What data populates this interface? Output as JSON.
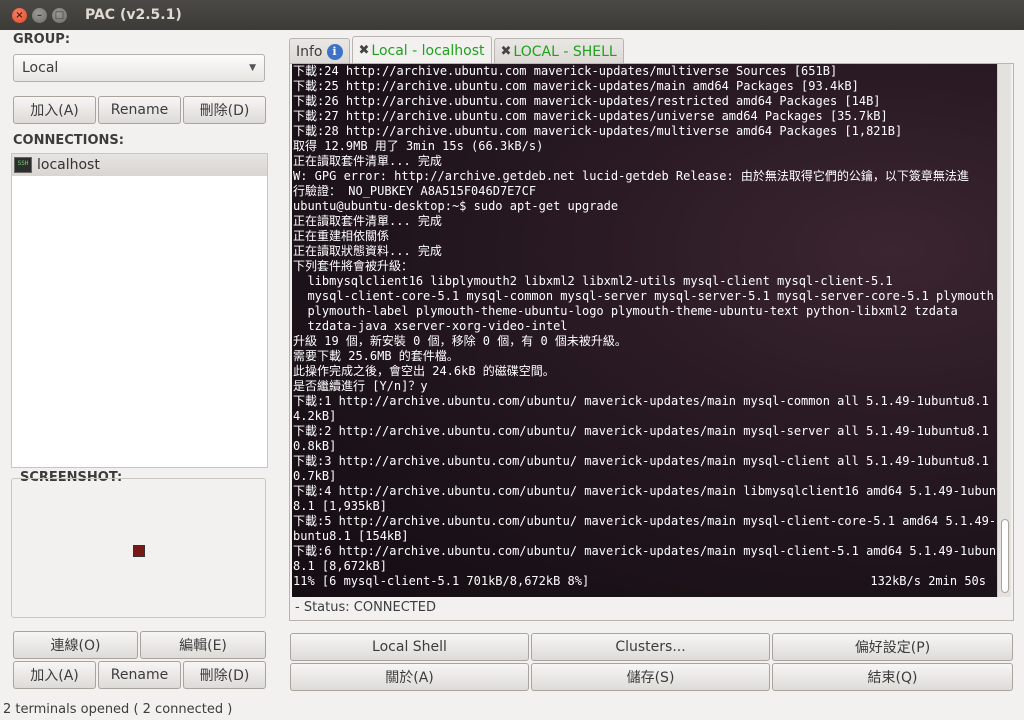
{
  "window": {
    "title": "PAC (v2.5.1)",
    "close_glyph": "×",
    "min_glyph": "–",
    "max_glyph": "□"
  },
  "left": {
    "group_label": "GROUP:",
    "group_value": "Local",
    "group_arrow": "▼",
    "group_buttons": {
      "add": "加入(A)",
      "rename": "Rename",
      "delete": "刪除(D)"
    },
    "connections_label": "CONNECTIONS:",
    "connections": [
      {
        "icon_text": "SSH",
        "label": "localhost"
      }
    ],
    "screenshot_label": "SCREENSHOT:",
    "bottom_buttons": {
      "connect": "連線(O)",
      "edit": "編輯(E)",
      "add": "加入(A)",
      "rename": "Rename",
      "delete": "刪除(D)"
    }
  },
  "tabs": [
    {
      "label": "Info",
      "icon": "info-icon",
      "icon_glyph": "i"
    },
    {
      "label": "Local - localhost",
      "icon": "close-icon",
      "icon_glyph": "✖",
      "active": true
    },
    {
      "label": "LOCAL - SHELL",
      "icon": "close-icon",
      "icon_glyph": "✖"
    }
  ],
  "terminal": {
    "lines": [
      "下載:24 http://archive.ubuntu.com maverick-updates/multiverse Sources [651B]",
      "下載:25 http://archive.ubuntu.com maverick-updates/main amd64 Packages [93.4kB]",
      "下載:26 http://archive.ubuntu.com maverick-updates/restricted amd64 Packages [14B]",
      "下載:27 http://archive.ubuntu.com maverick-updates/universe amd64 Packages [35.7kB]",
      "下載:28 http://archive.ubuntu.com maverick-updates/multiverse amd64 Packages [1,821B]",
      "取得 12.9MB 用了 3min 15s (66.3kB/s)",
      "正在讀取套件清單... 完成",
      "W: GPG error: http://archive.getdeb.net lucid-getdeb Release: 由於無法取得它們的公鑰，以下簽章無法進",
      "行驗證： NO_PUBKEY A8A515F046D7E7CF",
      "ubuntu@ubuntu-desktop:~$ sudo apt-get upgrade",
      "正在讀取套件清單... 完成",
      "正在重建相依關係",
      "正在讀取狀態資料... 完成",
      "下列套件將會被升級：",
      "  libmysqlclient16 libplymouth2 libxml2 libxml2-utils mysql-client mysql-client-5.1",
      "  mysql-client-core-5.1 mysql-common mysql-server mysql-server-5.1 mysql-server-core-5.1 plymouth",
      "  plymouth-label plymouth-theme-ubuntu-logo plymouth-theme-ubuntu-text python-libxml2 tzdata",
      "  tzdata-java xserver-xorg-video-intel",
      "升級 19 個，新安裝 0 個，移除 0 個，有 0 個未被升級。",
      "需要下載 25.6MB 的套件檔。",
      "此操作完成之後，會空出 24.6kB 的磁碟空間。",
      "是否繼續進行 [Y/n]？y",
      "下載:1 http://archive.ubuntu.com/ubuntu/ maverick-updates/main mysql-common all 5.1.49-1ubuntu8.1 [6",
      "4.2kB]",
      "下載:2 http://archive.ubuntu.com/ubuntu/ maverick-updates/main mysql-server all 5.1.49-1ubuntu8.1 [6",
      "0.8kB]",
      "下載:3 http://archive.ubuntu.com/ubuntu/ maverick-updates/main mysql-client all 5.1.49-1ubuntu8.1 [6",
      "0.7kB]",
      "下載:4 http://archive.ubuntu.com/ubuntu/ maverick-updates/main libmysqlclient16 amd64 5.1.49-1ubuntu",
      "8.1 [1,935kB]",
      "下載:5 http://archive.ubuntu.com/ubuntu/ maverick-updates/main mysql-client-core-5.1 amd64 5.1.49-1u",
      "buntu8.1 [154kB]",
      "下載:6 http://archive.ubuntu.com/ubuntu/ maverick-updates/main mysql-client-5.1 amd64 5.1.49-1ubuntu",
      "8.1 [8,672kB]",
      "11% [6 mysql-client-5.1 701kB/8,672kB 8%]"
    ],
    "progress_right": "132kB/s 2min 50s",
    "status": "- Status: CONNECTED"
  },
  "right_buttons": {
    "local_shell": "Local Shell",
    "clusters": "Clusters...",
    "preferences": "偏好設定(P)",
    "about": "關於(A)",
    "save": "儲存(S)",
    "quit": "結束(Q)"
  },
  "statusbar": "2 terminals opened ( 2 connected )"
}
